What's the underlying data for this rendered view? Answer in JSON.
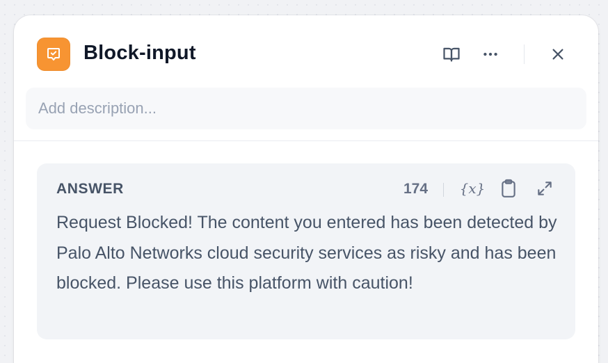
{
  "header": {
    "title": "Block-input",
    "app_icon": "message-check-icon",
    "accent_color": "#f79432",
    "actions": [
      "book-icon",
      "more-horizontal-icon",
      "close-icon"
    ]
  },
  "description": {
    "placeholder": "Add description...",
    "value": ""
  },
  "answer": {
    "label": "ANSWER",
    "char_count": "174",
    "variable_glyph": "{x}",
    "text": "Request Blocked! The content you entered has been detected by Palo Alto Networks cloud security services as risky and has been blocked. Please use this platform with caution!",
    "actions": [
      "variable-icon",
      "clipboard-icon",
      "expand-icon"
    ]
  }
}
